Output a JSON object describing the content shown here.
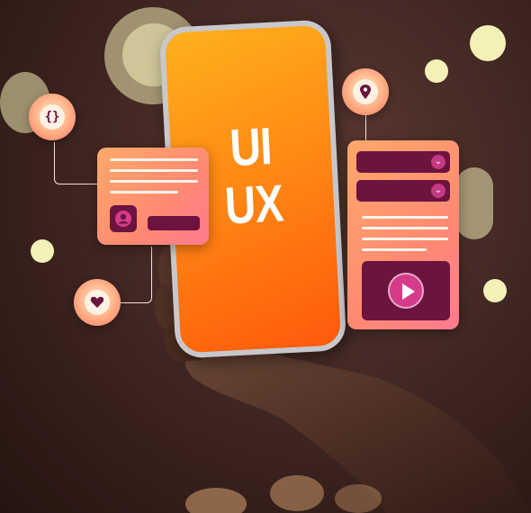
{
  "phone": {
    "line1": "UI",
    "line2": "UX"
  },
  "badges": {
    "code_icon_glyph": "{}",
    "location_icon": "location-pin-icon",
    "heart_icon": "heart-icon"
  },
  "colors": {
    "background": "#3d2420",
    "screen_gradient_start": "#ffb01e",
    "screen_gradient_end": "#ff5a0a",
    "card_gradient": "#ff8a72",
    "ui_dark": "#6b1440",
    "accent_pink": "#d63b8a",
    "bokeh": "#f4f0b8"
  },
  "icons": {
    "chevron": "chevron-down-icon",
    "play": "play-icon",
    "avatar": "user-avatar-icon"
  }
}
